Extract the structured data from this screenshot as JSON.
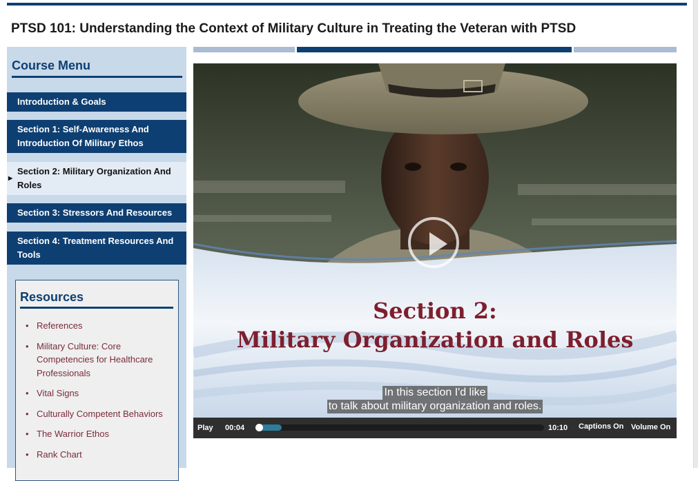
{
  "page_title": "PTSD 101: Understanding the Context of Military Culture in Treating the Veteran with PTSD",
  "course_menu": {
    "heading": "Course Menu",
    "items": [
      {
        "label": "Introduction & Goals",
        "active": false
      },
      {
        "label": "Section 1: Self-Awareness And Introduction Of Military Ethos",
        "active": false
      },
      {
        "label": "Section 2: Military Organization And Roles",
        "active": true
      },
      {
        "label": "Section 3: Stressors And Resources",
        "active": false
      },
      {
        "label": "Section 4: Treatment Resources And Tools",
        "active": false
      }
    ]
  },
  "resources": {
    "heading": "Resources",
    "items": [
      "References",
      "Military Culture: Core Competencies for Healthcare Professionals",
      "Vital Signs",
      "Culturally Competent Behaviors",
      "The Warrior Ethos",
      "Rank Chart"
    ]
  },
  "slide": {
    "title_line1": "Section 2:",
    "title_line2": "Military Organization and Roles"
  },
  "captions": {
    "line1": "In this section I'd like",
    "line2": "to talk about military organization and roles."
  },
  "player": {
    "play_label": "Play",
    "current_time": "00:04",
    "duration": "10:10",
    "captions_label": "Captions On",
    "volume_label": "Volume On",
    "buffered_fraction": 0.08,
    "played_fraction": 0.007
  },
  "colors": {
    "brand_navy": "#0e3f72",
    "sidebar_bg": "#c8d9ea",
    "link_maroon": "#7a2b3a",
    "slide_title": "#7d1f2e",
    "progress_light": "#a9bcd4"
  }
}
